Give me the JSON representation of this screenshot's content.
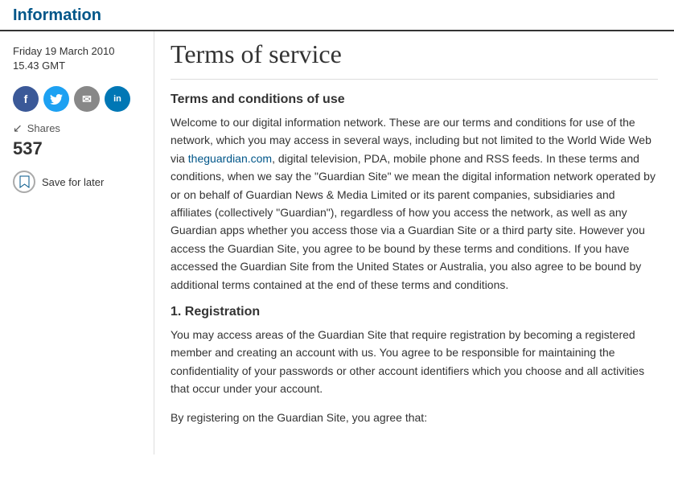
{
  "header": {
    "section_label": "Information"
  },
  "sidebar": {
    "date_line1": "Friday 19 March 2010",
    "date_line2": "15.43 GMT",
    "social_buttons": [
      {
        "label": "f",
        "name": "facebook",
        "class": "social-btn-facebook"
      },
      {
        "label": "t",
        "name": "twitter",
        "class": "social-btn-twitter"
      },
      {
        "label": "✉",
        "name": "email",
        "class": "social-btn-email"
      },
      {
        "label": "in",
        "name": "linkedin",
        "class": "social-btn-linkedin"
      }
    ],
    "shares_label": "Shares",
    "shares_count": "537",
    "save_later_label": "Save for later"
  },
  "main": {
    "page_title": "Terms of service",
    "intro_heading": "Terms and conditions of use",
    "intro_text1": "Welcome to our digital information network. These are our terms and conditions for use of the network, which you may access in several ways, including but not limited to the World Wide Web via ",
    "intro_link_text": "theguardian.com",
    "intro_link_href": "#",
    "intro_text2": ", digital television, PDA, mobile phone and RSS feeds. In these terms and conditions, when we say the \"Guardian Site\" we mean the digital information network operated by or on behalf of Guardian News & Media Limited or its parent companies, subsidiaries and affiliates (collectively \"Guardian\"), regardless of how you access the network, as well as any Guardian apps whether you access those via a Guardian Site or a third party site. However you access the Guardian Site, you agree to be bound by these terms and conditions. If you have accessed the Guardian Site from the United States or Australia, you also agree to be bound by additional terms contained at the end of these terms and conditions.",
    "section1_heading": "1. Registration",
    "section1_text1": "You may access areas of the Guardian Site that require registration by becoming a registered member and creating an account with us. You agree to be responsible for maintaining the confidentiality of your passwords or other account identifiers which you choose and all activities that occur under your account.",
    "section1_text2": "By registering on the Guardian Site, you agree that:"
  }
}
